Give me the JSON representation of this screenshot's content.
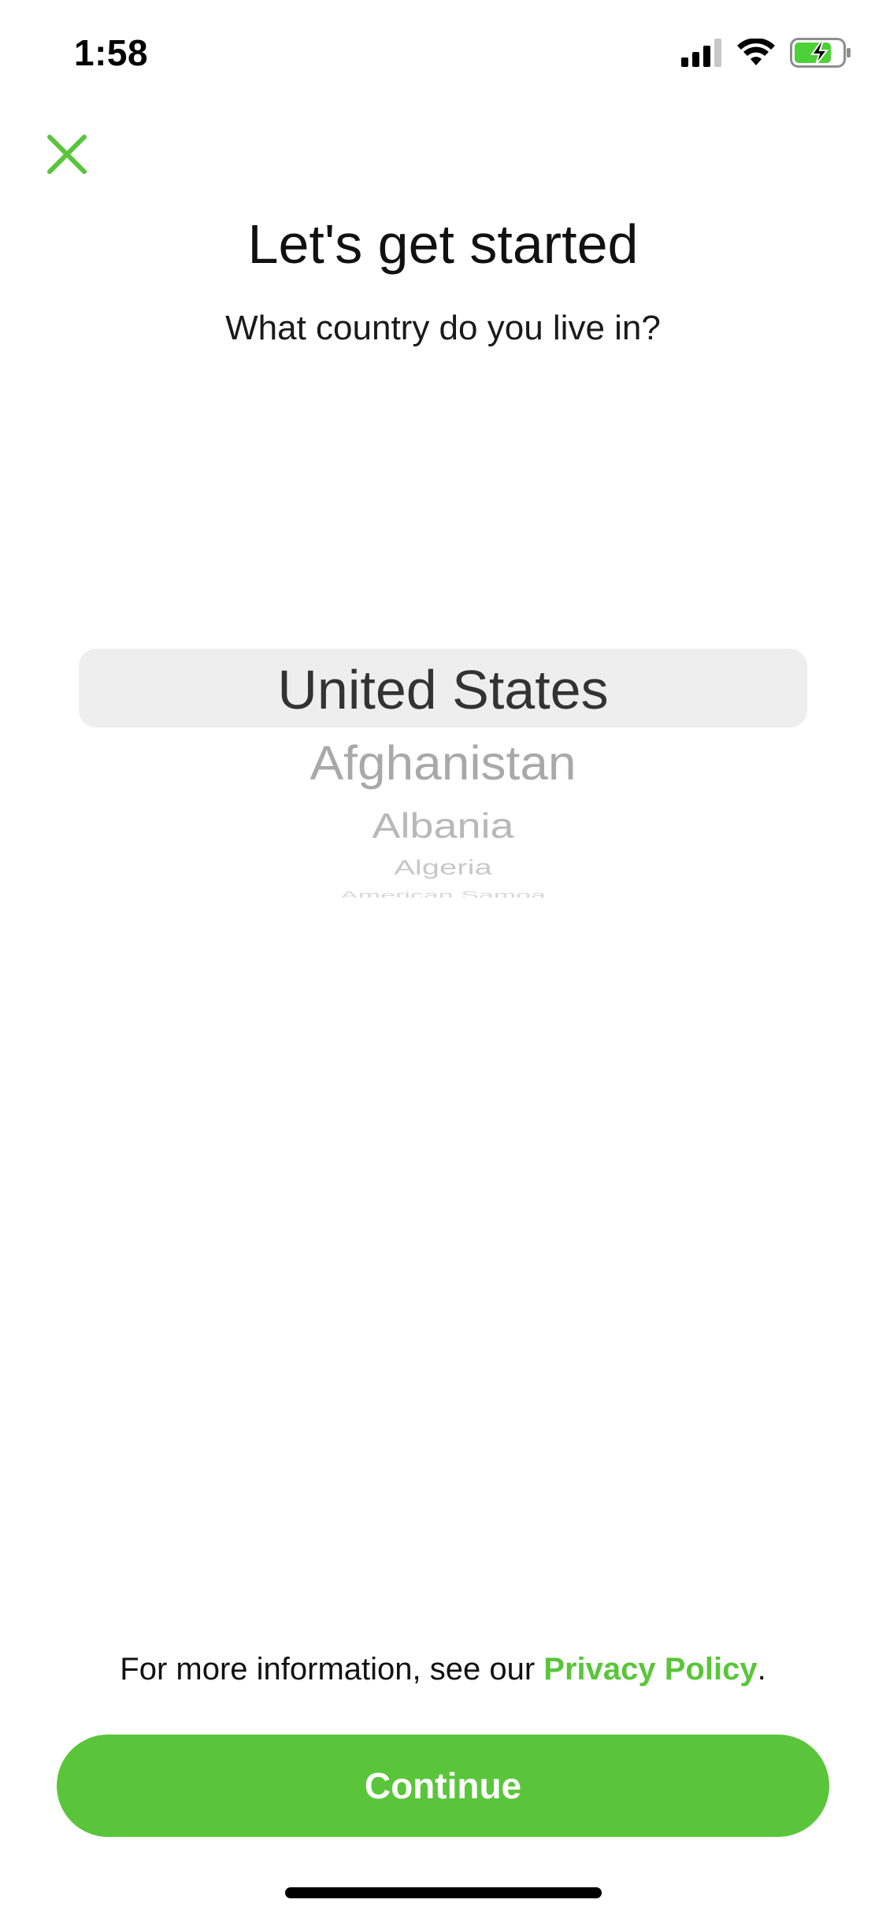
{
  "status_bar": {
    "time": "1:58",
    "icons": [
      "cellular-signal-icon",
      "wifi-icon",
      "battery-charging-icon"
    ]
  },
  "header": {
    "close_icon": "close-icon",
    "title": "Let's get started",
    "subtitle": "What country do you live in?"
  },
  "country_picker": {
    "selected": "United States",
    "options": [
      "Afghanistan",
      "Albania",
      "Algeria",
      "American Samoa"
    ]
  },
  "footer": {
    "privacy_prefix": "For more information, see our ",
    "privacy_link": "Privacy Policy",
    "privacy_suffix": ".",
    "continue_label": "Continue"
  },
  "colors": {
    "accent": "#5ac53b",
    "picker_highlight": "#eeeeef",
    "button_text": "#ffffff"
  }
}
